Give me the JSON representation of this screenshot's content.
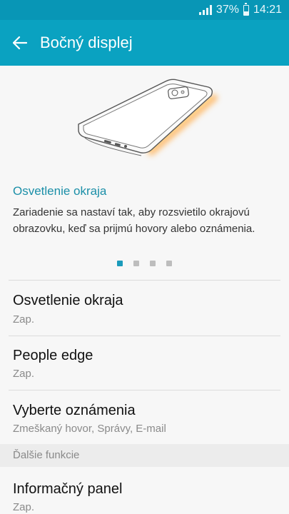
{
  "status": {
    "battery_percent": "37%",
    "time": "14:21"
  },
  "header": {
    "title": "Bočný displej"
  },
  "feature_card": {
    "title": "Osvetlenie okraja",
    "description": "Zariadenie sa nastaví tak, aby rozsvietilo okrajovú obrazovku, keď sa prijmú hovory alebo oznámenia.",
    "pages": 4,
    "active_page": 1
  },
  "settings": [
    {
      "label": "Osvetlenie okraja",
      "value": "Zap."
    },
    {
      "label": "People edge",
      "value": "Zap."
    },
    {
      "label": "Vyberte oznámenia",
      "value": "Zmeškaný hovor, Správy, E-mail"
    }
  ],
  "section_header": "Ďalšie funkcie",
  "more_settings": [
    {
      "label": "Informačný panel",
      "value": "Zap."
    }
  ],
  "colors": {
    "accent": "#0aa2c1",
    "status_bar": "#0896b6",
    "edge_glow": "#ffb45a",
    "link_text": "#1b8fa8"
  },
  "icons": {
    "back": "arrow-left-icon",
    "signal": "signal-bars-icon",
    "battery": "battery-icon"
  }
}
